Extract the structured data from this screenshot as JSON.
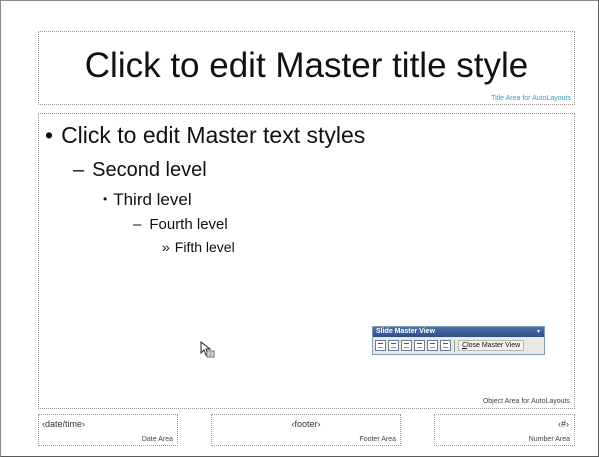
{
  "title_area": {
    "title_text": "Click to edit Master title style",
    "label": "Title Area for AutoLayouts"
  },
  "object_area": {
    "levels": [
      {
        "bullet": "•",
        "text": "Click to edit Master text styles"
      },
      {
        "bullet": "–",
        "text": "Second level"
      },
      {
        "bullet": "•",
        "text": "Third level"
      },
      {
        "bullet": "–",
        "text": "Fourth level"
      },
      {
        "bullet": "»",
        "text": "Fifth level"
      }
    ],
    "label": "Object Area for AutoLayouts"
  },
  "toolbar": {
    "title": "Slide Master View",
    "dropdown_glyph": "▾",
    "icons": [
      "insert-new-slide-master-icon",
      "insert-new-title-master-icon",
      "delete-master-icon",
      "preserve-master-icon",
      "rename-master-icon",
      "master-layout-icon"
    ],
    "close_label_accel": "C",
    "close_label_rest": "lose Master View"
  },
  "footer": {
    "date": {
      "value": "‹date/time›",
      "label": "Date Area"
    },
    "footer": {
      "value": "‹footer›",
      "label": "Footer Area"
    },
    "number": {
      "value": "‹#›",
      "label": "Number Area"
    }
  },
  "colors": {
    "title_label": "#3aa0b8",
    "toolbar_title_bar": "#2c4f8c",
    "toolbar_bg": "#eae8e2"
  }
}
